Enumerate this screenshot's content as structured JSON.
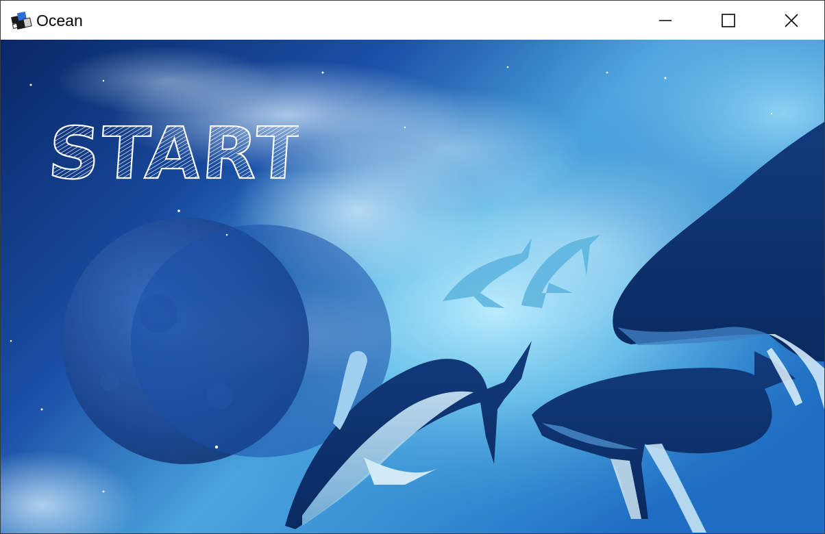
{
  "window": {
    "title": "Ocean",
    "app_icon": "app-logo-icon",
    "controls": {
      "minimize_icon": "minimize-icon",
      "maximize_icon": "maximize-icon",
      "close_icon": "close-icon"
    }
  },
  "main": {
    "background": "ocean-sky-whales-illustration",
    "start_label": "START"
  },
  "colors": {
    "deep_blue": "#0b2a6b",
    "mid_blue": "#1f5fb8",
    "light_blue": "#7fd3f2",
    "whale_dark": "#0d3470",
    "titlebar_bg": "#ffffff",
    "start_text": "#ffffff"
  }
}
